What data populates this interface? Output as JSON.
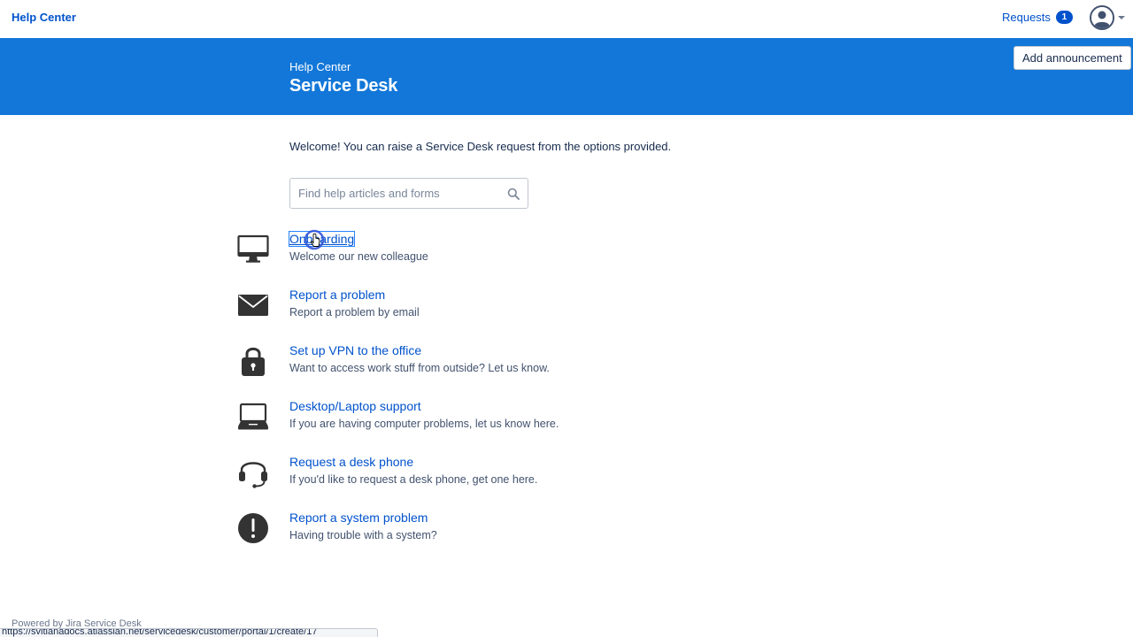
{
  "topbar": {
    "brand": "Help Center",
    "requests_label": "Requests",
    "requests_count": "1"
  },
  "banner": {
    "subtitle": "Help Center",
    "title": "Service Desk",
    "announcement_button": "Add announcement",
    "color": "#1277d8"
  },
  "main": {
    "welcome": "Welcome! You can raise a Service Desk request from the options provided.",
    "search_placeholder": "Find help articles and forms"
  },
  "request_types": [
    {
      "icon": "monitor-icon",
      "label": "Onboarding",
      "description": "Welcome our new colleague"
    },
    {
      "icon": "envelope-icon",
      "label": "Report a problem",
      "description": "Report a problem by email"
    },
    {
      "icon": "lock-icon",
      "label": "Set up VPN to the office",
      "description": "Want to access work stuff from outside? Let us know."
    },
    {
      "icon": "laptop-icon",
      "label": "Desktop/Laptop support",
      "description": "If you are having computer problems, let us know here."
    },
    {
      "icon": "headset-icon",
      "label": "Request a desk phone",
      "description": "If you'd like to request a desk phone, get one here."
    },
    {
      "icon": "alert-icon",
      "label": "Report a system problem",
      "description": "Having trouble with a system?"
    }
  ],
  "footer": {
    "powered_by": "Powered by Jira Service Desk",
    "status_url": "https://svitlanadocs.atlassian.net/servicedesk/customer/portal/1/create/17"
  },
  "colors": {
    "link": "#0052cc",
    "text": "#172b4d",
    "icon": "#333333"
  }
}
